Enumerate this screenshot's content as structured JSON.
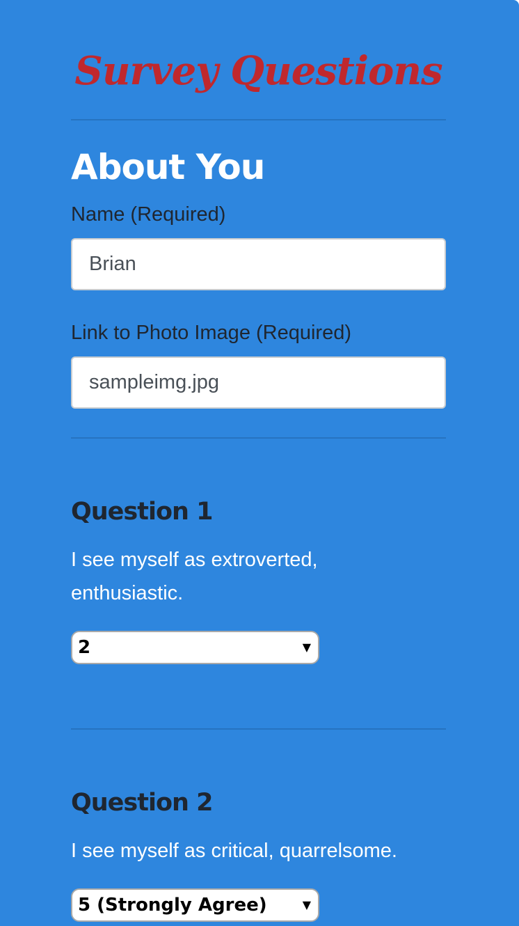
{
  "header": {
    "title": "Survey Questions"
  },
  "about": {
    "heading": "About You",
    "name_label": "Name (Required)",
    "name_value": "Brian",
    "photo_label": "Link to Photo Image (Required)",
    "photo_value": "sampleimg.jpg"
  },
  "questions": [
    {
      "heading": "Question 1",
      "text": "I see myself as extroverted, enthusiastic.",
      "selected": "2"
    },
    {
      "heading": "Question 2",
      "text": "I see myself as critical, quarrelsome.",
      "selected": "5 (Strongly Agree)"
    }
  ],
  "colors": {
    "background": "#2e86de",
    "title": "#c0282d"
  },
  "icons": {
    "dropdown": "caret-down-icon"
  }
}
